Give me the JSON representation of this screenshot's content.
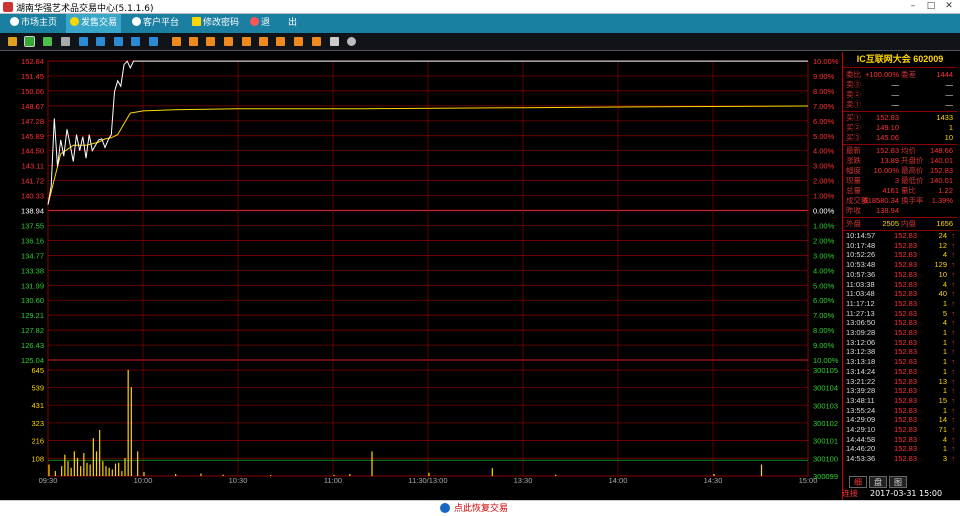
{
  "app": {
    "title": "湖南华强艺术品交易中心(5.1.1.6)"
  },
  "menu": [
    {
      "label": "市场主页"
    },
    {
      "label": "发售交易"
    },
    {
      "label": "客户平台"
    },
    {
      "label": "修改密码"
    },
    {
      "label": "退　　出"
    }
  ],
  "chart_data": {
    "type": "line",
    "x_ticks": [
      "09:30",
      "10:00",
      "10:30",
      "11:00",
      "11:30/13:00",
      "13:30",
      "14:00",
      "14:30",
      "15:00"
    ],
    "price_ticks": [
      "152.84",
      "151.45",
      "150.06",
      "148.67",
      "147.28",
      "145.89",
      "144.50",
      "143.11",
      "141.72",
      "140.33",
      "138.94",
      "137.55",
      "136.16",
      "134.77",
      "133.38",
      "131.99",
      "130.60",
      "129.21",
      "127.82",
      "126.43",
      "125.04"
    ],
    "pct_ticks": [
      "10.00%",
      "9.00%",
      "8.00%",
      "7.00%",
      "6.00%",
      "5.00%",
      "4.00%",
      "3.00%",
      "2.00%",
      "1.00%",
      "0.00%",
      "1.00%",
      "2.00%",
      "3.00%",
      "4.00%",
      "5.00%",
      "6.00%",
      "7.00%",
      "8.00%",
      "9.00%",
      "10.00%"
    ],
    "price_range": [
      125.04,
      152.84
    ],
    "prev_close": 138.94,
    "volume_ticks": [
      "645",
      "539",
      "431",
      "323",
      "216",
      "108"
    ],
    "volume_range": [
      0,
      645
    ],
    "right_vol_ticks": [
      "300105",
      "300104",
      "300103",
      "300102",
      "300101",
      "300100",
      "300099"
    ],
    "price_series": {
      "x": [
        0,
        1,
        2,
        3,
        4,
        5,
        6,
        7,
        8,
        9,
        10,
        11,
        12,
        13,
        14,
        15,
        16,
        17,
        18,
        19,
        20,
        21,
        22,
        23,
        24,
        25,
        26,
        27,
        28,
        29,
        30,
        31,
        32,
        33,
        34,
        35,
        40,
        60,
        120,
        240
      ],
      "values": [
        139.5,
        141.2,
        147.5,
        143,
        145.5,
        144,
        146.5,
        145,
        143.5,
        146,
        144.5,
        145.8,
        143.8,
        146,
        144.5,
        145,
        145.5,
        145.6,
        144.8,
        145.5,
        146,
        150,
        151,
        150.5,
        152.5,
        152.83,
        152.2,
        152.83,
        152.83,
        152.83,
        152.83,
        152.83,
        152.83,
        152.83,
        152.83,
        152.83,
        152.83,
        152.83,
        152.83,
        152.83
      ]
    },
    "avg_series": {
      "x": [
        0,
        4,
        8,
        12,
        16,
        18,
        20,
        22,
        24,
        26,
        28,
        30,
        40,
        60,
        100,
        150,
        200,
        240
      ],
      "values": [
        139.5,
        144.2,
        145,
        145,
        145.3,
        145.6,
        145.7,
        146,
        147,
        148,
        148.1,
        148.2,
        148.3,
        148.4,
        148.4,
        148.5,
        148.6,
        148.66
      ]
    },
    "volume_bars": {
      "x": [
        0,
        2,
        4,
        5,
        6,
        7,
        8,
        9,
        10,
        11,
        12,
        13,
        14,
        15,
        16,
        17,
        18,
        19,
        20,
        21,
        22,
        23,
        24,
        25,
        26,
        28,
        30,
        40,
        48,
        55,
        70,
        90,
        95,
        102,
        120,
        140,
        160,
        210,
        225
      ],
      "values": [
        70,
        30,
        60,
        130,
        90,
        50,
        150,
        110,
        60,
        140,
        80,
        70,
        230,
        150,
        280,
        90,
        60,
        50,
        40,
        75,
        80,
        30,
        110,
        665,
        540,
        150,
        25,
        12,
        15,
        8,
        6,
        7,
        12,
        150,
        20,
        48,
        8,
        12,
        70
      ]
    }
  },
  "quote": {
    "header": "IC互联网大会 602009",
    "webi_label": "委比",
    "webi_value": "+100.00%",
    "weicha_label": "委差",
    "weicha_value": "1444",
    "sell": [
      {
        "label": "卖③",
        "price": "—",
        "vol": "—"
      },
      {
        "label": "卖②",
        "price": "—",
        "vol": "—"
      },
      {
        "label": "卖①",
        "price": "—",
        "vol": "—"
      }
    ],
    "buy": [
      {
        "label": "买①",
        "price": "152.83",
        "vol": "1433"
      },
      {
        "label": "买②",
        "price": "149.10",
        "vol": "1"
      },
      {
        "label": "买③",
        "price": "145.06",
        "vol": "10"
      }
    ],
    "stats": [
      {
        "k1": "最新",
        "v1": "152.83",
        "k2": "均价",
        "v2": "148.66"
      },
      {
        "k1": "涨跌",
        "v1": "13.89",
        "k2": "开盘价",
        "v2": "140.01"
      },
      {
        "k1": "幅度",
        "v1": "10.00%",
        "k2": "最高价",
        "v2": "152.83"
      },
      {
        "k1": "现量",
        "v1": "3",
        "k2": "最低价",
        "v2": "140.01"
      },
      {
        "k1": "总量",
        "v1": "4161",
        "k2": "量比",
        "v2": "1.22"
      },
      {
        "k1": "成交额",
        "v1": "618580.34",
        "k2": "换手率",
        "v2": "1.39%"
      },
      {
        "k1": "昨收",
        "v1": "138.94",
        "k2": "",
        "v2": ""
      }
    ],
    "waipan_label": "外盘",
    "waipan_value": "2505",
    "neipan_label": "内盘",
    "neipan_value": "1656",
    "ticks": [
      {
        "time": "10:14:57",
        "price": "152.83",
        "vol": "24"
      },
      {
        "time": "10:17:48",
        "price": "152.83",
        "vol": "12"
      },
      {
        "time": "10:52:26",
        "price": "152.83",
        "vol": "4"
      },
      {
        "time": "10:53:48",
        "price": "152.83",
        "vol": "129"
      },
      {
        "time": "10:57:36",
        "price": "152.83",
        "vol": "10"
      },
      {
        "time": "11:03:38",
        "price": "152.83",
        "vol": "4"
      },
      {
        "time": "11:03:48",
        "price": "152.83",
        "vol": "40"
      },
      {
        "time": "11:17:12",
        "price": "152.83",
        "vol": "1"
      },
      {
        "time": "11:27:13",
        "price": "152.83",
        "vol": "5"
      },
      {
        "time": "13:06:50",
        "price": "152.83",
        "vol": "4"
      },
      {
        "time": "13:09:28",
        "price": "152.83",
        "vol": "1"
      },
      {
        "time": "13:12:06",
        "price": "152.83",
        "vol": "1"
      },
      {
        "time": "13:12:38",
        "price": "152.83",
        "vol": "1"
      },
      {
        "time": "13:13:18",
        "price": "152.83",
        "vol": "1"
      },
      {
        "time": "13:14:24",
        "price": "152.83",
        "vol": "1"
      },
      {
        "time": "13:21:22",
        "price": "152.83",
        "vol": "13"
      },
      {
        "time": "13:39:28",
        "price": "152.83",
        "vol": "1"
      },
      {
        "time": "13:48:11",
        "price": "152.83",
        "vol": "15"
      },
      {
        "time": "13:55:24",
        "price": "152.83",
        "vol": "1"
      },
      {
        "time": "14:29:09",
        "price": "152.83",
        "vol": "14"
      },
      {
        "time": "14:29:10",
        "price": "152.83",
        "vol": "71"
      },
      {
        "time": "14:44:58",
        "price": "152.83",
        "vol": "4"
      },
      {
        "time": "14:46:20",
        "price": "152.83",
        "vol": "1"
      },
      {
        "time": "14:53:36",
        "price": "152.83",
        "vol": "3"
      }
    ],
    "tabs": [
      "细",
      "盘",
      "图"
    ],
    "status": "连接",
    "datetime": "2017-03-31 15:00"
  },
  "bottom": {
    "label": "点此恢复交易"
  },
  "colors": {
    "up": "#ff3333",
    "down": "#33cc33",
    "grid": "#8b0000",
    "price": "#ffffff",
    "avg": "#ffd700",
    "accent": "#1b7fa2"
  }
}
